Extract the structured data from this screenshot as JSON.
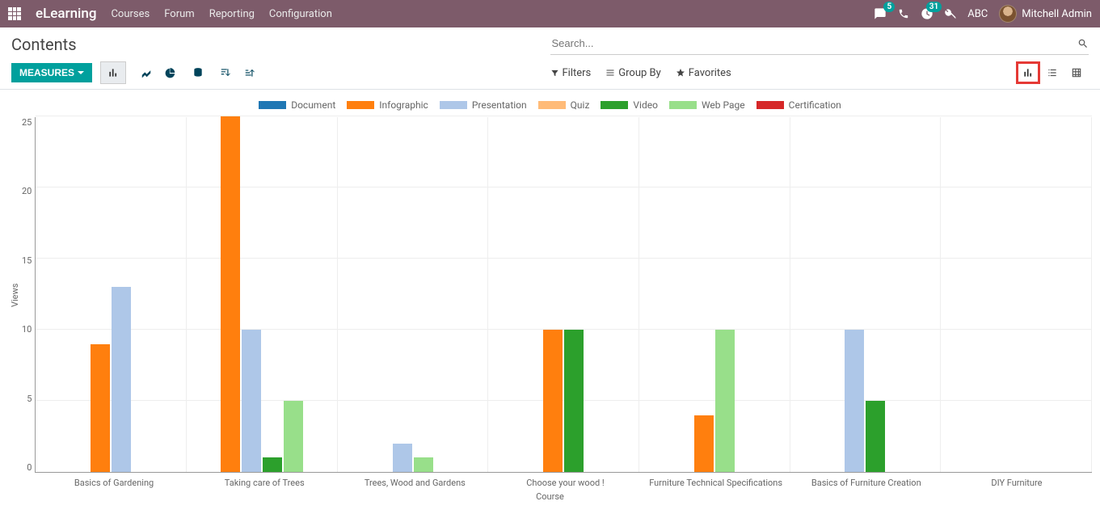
{
  "nav": {
    "brand": "eLearning",
    "menus": [
      "Courses",
      "Forum",
      "Reporting",
      "Configuration"
    ],
    "msg_badge": "5",
    "activity_badge": "31",
    "company": "ABC",
    "user": "Mitchell Admin"
  },
  "page": {
    "title": "Contents",
    "search_placeholder": "Search...",
    "measures_label": "MEASURES",
    "filters_label": "Filters",
    "groupby_label": "Group By",
    "favorites_label": "Favorites"
  },
  "chart_data": {
    "type": "bar",
    "title": "",
    "xlabel": "Course",
    "ylabel": "Views",
    "ylim": [
      0,
      25
    ],
    "yticks": [
      0,
      5,
      10,
      15,
      20,
      25
    ],
    "categories": [
      "Basics of Gardening",
      "Taking care of Trees",
      "Trees, Wood and Gardens",
      "Choose your wood !",
      "Furniture Technical Specifications",
      "Basics of Furniture Creation",
      "DIY Furniture"
    ],
    "series": [
      {
        "name": "Document",
        "color": "#1f77b4",
        "values": [
          null,
          null,
          null,
          null,
          null,
          null,
          null
        ]
      },
      {
        "name": "Infographic",
        "color": "#ff7f0e",
        "values": [
          9,
          25,
          null,
          10,
          4,
          null,
          null
        ]
      },
      {
        "name": "Presentation",
        "color": "#aec7e8",
        "values": [
          13,
          10,
          2,
          null,
          null,
          10,
          null
        ]
      },
      {
        "name": "Quiz",
        "color": "#ffbb78",
        "values": [
          null,
          null,
          null,
          null,
          null,
          null,
          null
        ]
      },
      {
        "name": "Video",
        "color": "#2ca02c",
        "values": [
          null,
          1,
          null,
          10,
          null,
          5,
          null
        ]
      },
      {
        "name": "Web Page",
        "color": "#98df8a",
        "values": [
          null,
          5,
          1,
          null,
          10,
          null,
          null
        ]
      },
      {
        "name": "Certification",
        "color": "#d62728",
        "values": [
          null,
          null,
          null,
          null,
          null,
          null,
          null
        ]
      }
    ]
  }
}
